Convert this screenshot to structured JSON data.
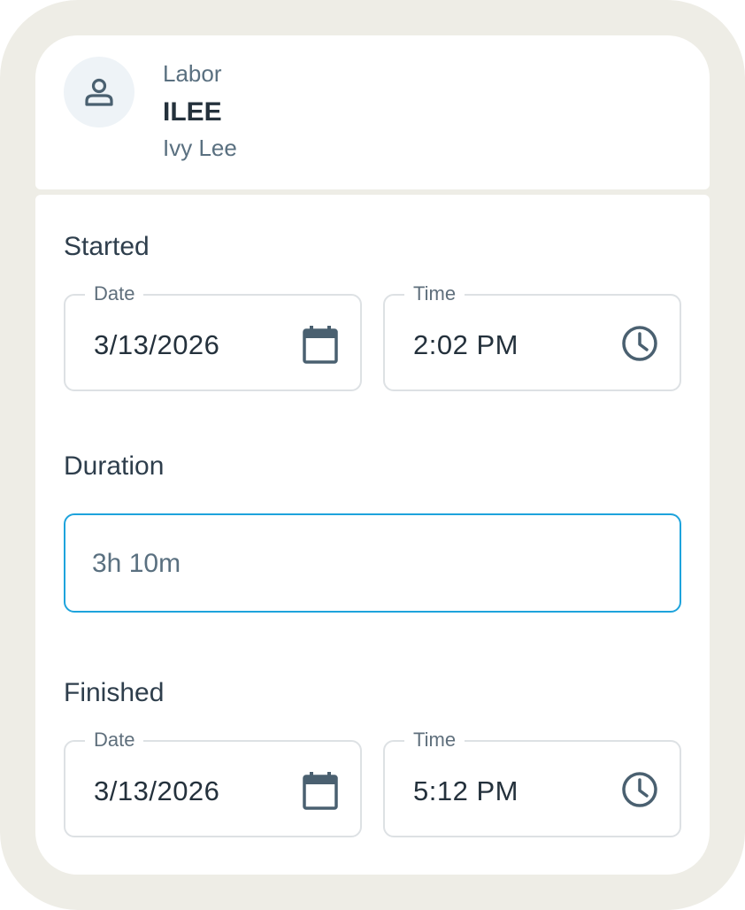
{
  "header": {
    "category": "Labor",
    "code": "ILEE",
    "name": "Ivy Lee",
    "avatar_icon": "person-icon"
  },
  "started": {
    "label": "Started",
    "date": {
      "legend": "Date",
      "value": "3/13/2026",
      "icon": "calendar-icon"
    },
    "time": {
      "legend": "Time",
      "value": "2:02 PM",
      "icon": "clock-icon"
    }
  },
  "duration": {
    "label": "Duration",
    "placeholder": "3h 10m",
    "value": ""
  },
  "finished": {
    "label": "Finished",
    "date": {
      "legend": "Date",
      "value": "3/13/2026",
      "icon": "calendar-icon"
    },
    "time": {
      "legend": "Time",
      "value": "5:12 PM",
      "icon": "clock-icon"
    }
  },
  "colors": {
    "accent": "#1ea3dc",
    "icon": "#4a6070",
    "frame": "#eeede6",
    "text_dark": "#24313c",
    "text_muted": "#5a7080"
  }
}
